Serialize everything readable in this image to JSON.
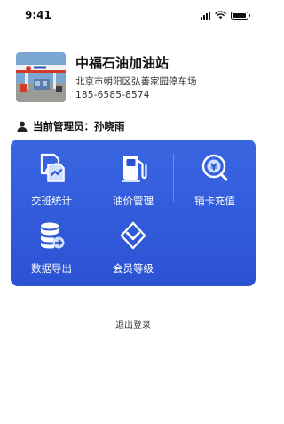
{
  "status_bar": {
    "time": "9:41"
  },
  "station": {
    "name": "中福石油加油站",
    "address": "北京市朝阳区弘善家园停车场",
    "phone": "185-6585-8574"
  },
  "manager": {
    "label": "当前管理员：孙晓雨"
  },
  "menu": {
    "items": [
      {
        "label": "交班统计",
        "icon": "shift-report-icon"
      },
      {
        "label": "油价管理",
        "icon": "fuel-pump-icon"
      },
      {
        "label": "销卡充值",
        "icon": "card-recharge-icon"
      },
      {
        "label": "数据导出",
        "icon": "data-export-icon"
      },
      {
        "label": "会员等级",
        "icon": "member-level-icon"
      }
    ]
  },
  "logout_label": "退出登录",
  "colors": {
    "panel": "#2f58da",
    "panel_text": "#ffffff",
    "icon_accent": "#cfe0ff"
  }
}
